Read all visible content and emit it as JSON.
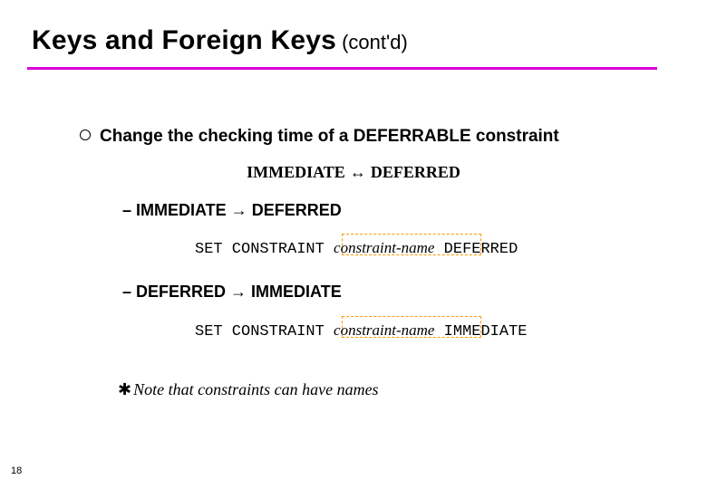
{
  "title": {
    "main": "Keys and Foreign Keys",
    "suffix": " (cont'd)"
  },
  "bullet": {
    "text": "Change the checking time of a DEFERRABLE constraint"
  },
  "summary": {
    "left": "IMMEDIATE",
    "arrow": " ↔ ",
    "right": "DEFERRED"
  },
  "sub1": {
    "dash": "– ",
    "from": "IMMEDIATE",
    "arrow": " → ",
    "to": "DEFERRED"
  },
  "code1": {
    "prefix": "SET CONSTRAINT ",
    "cname": "constraint-name",
    "suffix": " DEFERRED"
  },
  "sub2": {
    "dash": "– ",
    "from": "DEFERRED",
    "arrow": " → ",
    "to": "IMMEDIATE"
  },
  "code2": {
    "prefix": "SET CONSTRAINT ",
    "cname": "constraint-name",
    "suffix": " IMMEDIATE"
  },
  "note": {
    "star": "✱",
    "text": "Note that constraints can have names"
  },
  "page": "18"
}
